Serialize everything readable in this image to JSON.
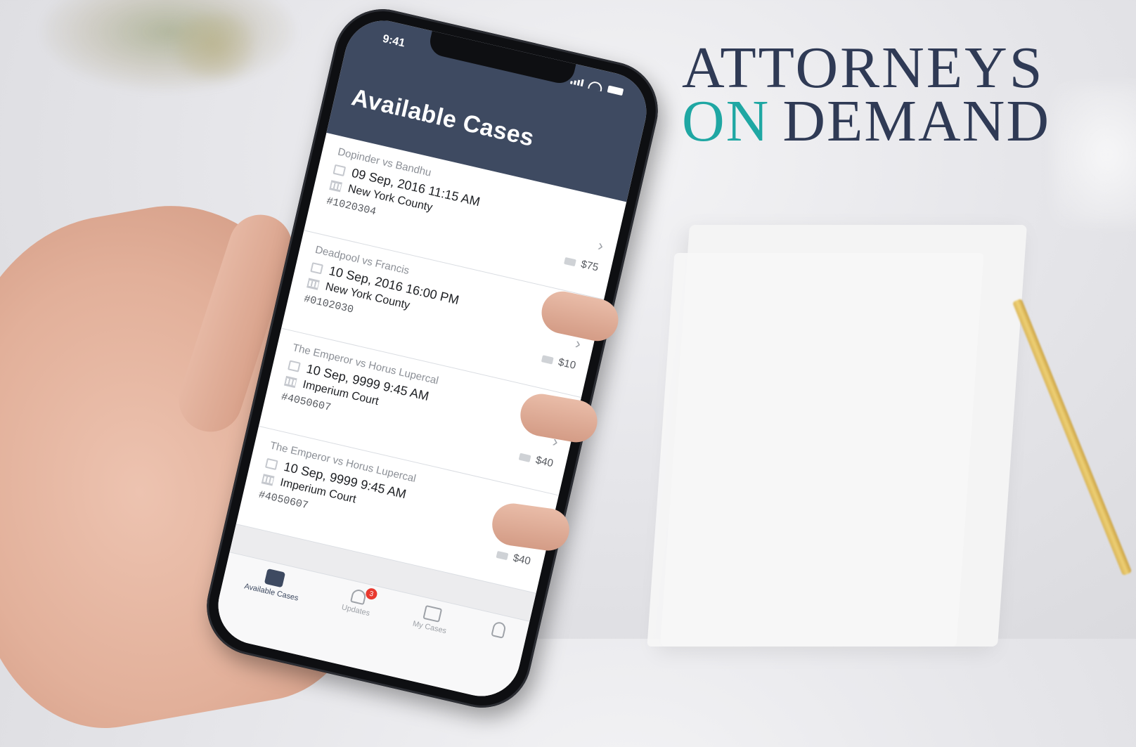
{
  "logo": {
    "line1": "ATTORNEYS",
    "on": "ON",
    "demand": "DEMAND"
  },
  "status": {
    "time": "9:41"
  },
  "header": {
    "title": "Available Cases"
  },
  "cases": [
    {
      "name": "Dopinder vs Bandhu",
      "date": "09 Sep, 2016  11:15 AM",
      "court": "New York County",
      "number": "#1020304",
      "fee": "$75"
    },
    {
      "name": "Deadpool vs Francis",
      "date": "10 Sep, 2016  16:00 PM",
      "court": "New York County",
      "number": "#0102030",
      "fee": "$10"
    },
    {
      "name": "The Emperor vs Horus Lupercal",
      "date": "10 Sep, 9999  9:45 AM",
      "court": "Imperium Court",
      "number": "#4050607",
      "fee": "$40"
    },
    {
      "name": "The Emperor vs Horus Lupercal",
      "date": "10 Sep, 9999  9:45 AM",
      "court": "Imperium Court",
      "number": "#4050607",
      "fee": "$40"
    }
  ],
  "tabs": {
    "available": "Available Cases",
    "updates": "Updates",
    "updates_badge": "3",
    "mycases": "My Cases"
  },
  "icons": {
    "chevron": "›"
  },
  "colors": {
    "header": "#3e4a61",
    "accent_teal": "#1fa7a3",
    "brand_navy": "#2f3a55",
    "badge": "#e8392f"
  }
}
